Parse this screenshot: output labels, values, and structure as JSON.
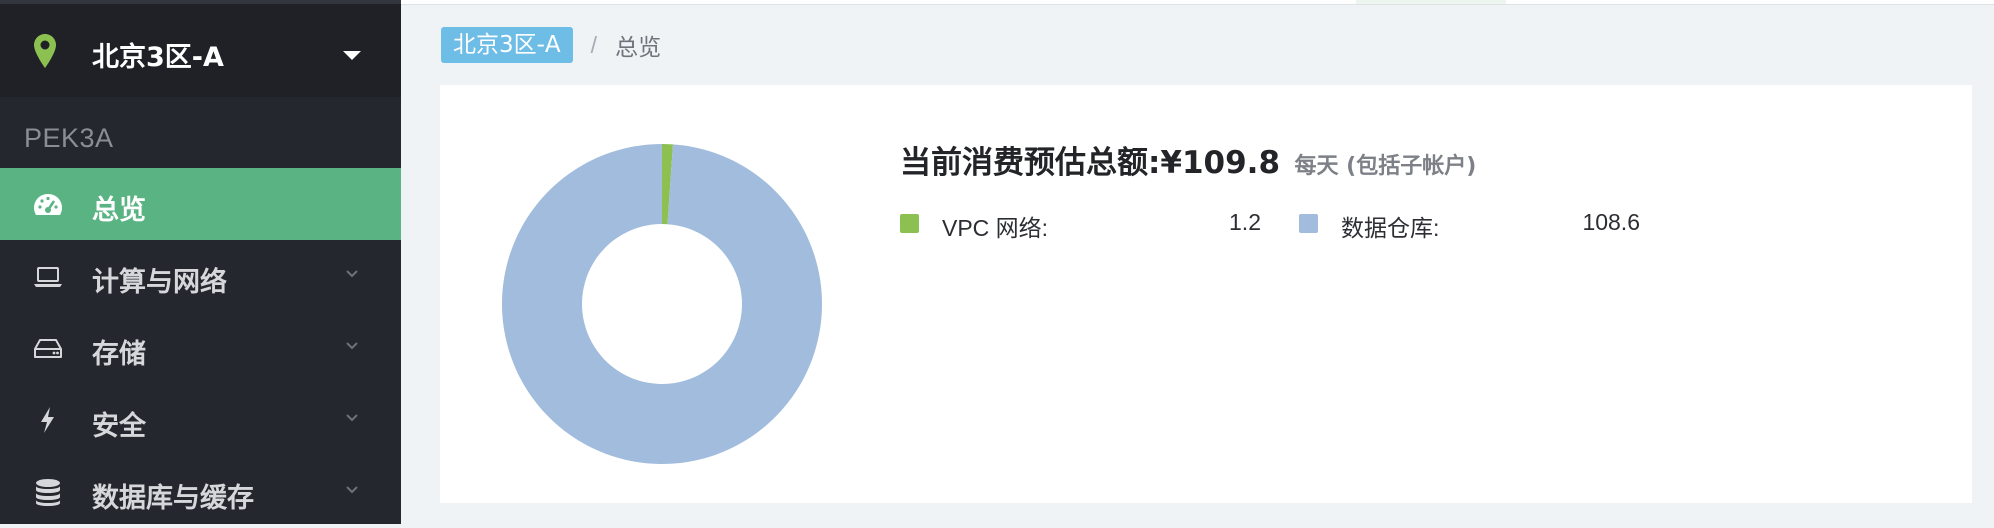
{
  "region": {
    "name": "北京3区-A",
    "pin_color": "#8cc152"
  },
  "zone_code": "PEK3A",
  "nav": {
    "items": [
      {
        "label": "总览",
        "icon": "dashboard-icon",
        "active": true
      },
      {
        "label": "计算与网络",
        "icon": "laptop-icon",
        "active": false
      },
      {
        "label": "存储",
        "icon": "hard-drive-icon",
        "active": false
      },
      {
        "label": "安全",
        "icon": "bolt-icon",
        "active": false
      },
      {
        "label": "数据库与缓存",
        "icon": "database-icon",
        "active": false
      }
    ]
  },
  "breadcrumb": {
    "root": "北京3区-A",
    "separator": "/",
    "current": "总览"
  },
  "summary": {
    "label": "当前消费预估总额:",
    "amount": "¥109.8",
    "note": "每天 (包括子帐户)"
  },
  "legend": [
    {
      "name": "VPC 网络:",
      "value": "1.2",
      "color": "#8cc152"
    },
    {
      "name": "数据仓库:",
      "value": "108.6",
      "color": "#a1bcdc"
    }
  ],
  "chart_data": {
    "type": "pie",
    "donut": true,
    "categories": [
      "VPC 网络",
      "数据仓库"
    ],
    "values": [
      1.2,
      108.6
    ],
    "colors": [
      "#8cc152",
      "#a1bcdc"
    ]
  },
  "colors": {
    "sidebar_bg": "#25272e",
    "active_bg": "#5ab383",
    "crumb_tag_bg": "#6ebde6"
  }
}
